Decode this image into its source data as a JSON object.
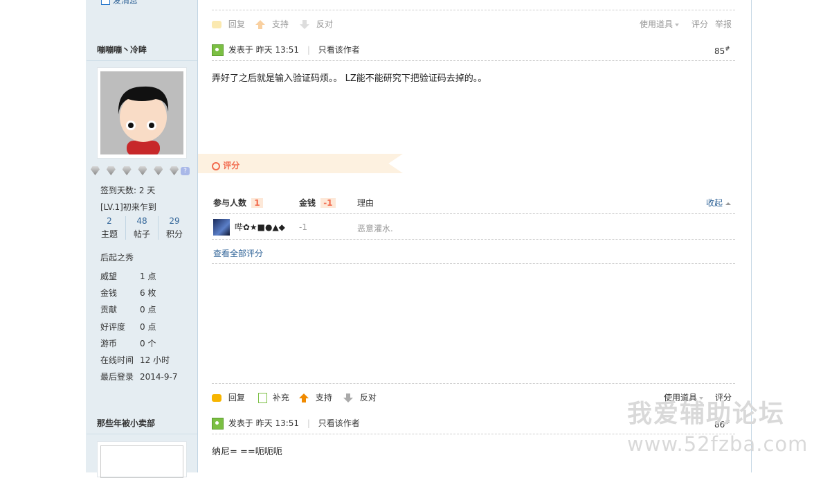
{
  "sidebar": {
    "top_link": "发消息",
    "user1": {
      "name": "嘣嘣嘣丶冷眸",
      "stats": [
        {
          "value": "2",
          "label": "主题"
        },
        {
          "value": "48",
          "label": "帖子"
        },
        {
          "value": "29",
          "label": "积分"
        }
      ],
      "sign_days": "签到天数: 2 天",
      "level": "[LV.1]初来乍到",
      "title": "后起之秀",
      "details": [
        {
          "key": "威望",
          "value": "1 点"
        },
        {
          "key": "金钱",
          "value": "6 枚"
        },
        {
          "key": "贡献",
          "value": "0 点"
        },
        {
          "key": "好评度",
          "value": "0 点"
        },
        {
          "key": "游币",
          "value": "0 个"
        },
        {
          "key": "在线时间",
          "value": "12 小时"
        },
        {
          "key": "最后登录",
          "value": "2014-9-7"
        }
      ]
    },
    "user2": {
      "name": "那些年被小卖部"
    }
  },
  "post85": {
    "top_actions": {
      "reply": "回复",
      "support": "支持",
      "oppose": "反对",
      "tools": "使用道具",
      "rate": "评分",
      "report": "举报"
    },
    "posted": "发表于 昨天 13:51",
    "only_author": "只看该作者",
    "floor": "85",
    "floor_mark": "#",
    "content": "弄好了之后就是输入验证码烦。。 LZ能不能研究下把验证码去掉的。。",
    "rating_title": "评分",
    "rating": {
      "participants_label": "参与人数",
      "participants": "1",
      "money_label": "金钱",
      "money": "-1",
      "reason_label": "理由",
      "collapse": "收起",
      "rows": [
        {
          "user": "哔✿★■●▲◆",
          "money": "-1",
          "reason": "恶意灌水."
        }
      ],
      "view_all": "查看全部评分"
    },
    "bottom_actions": {
      "reply": "回复",
      "supplement": "补充",
      "support": "支持",
      "oppose": "反对",
      "tools": "使用道具",
      "rate": "评分"
    }
  },
  "post86": {
    "posted": "发表于 昨天 13:51",
    "only_author": "只看该作者",
    "floor": "86",
    "floor_mark": "#",
    "content": "纳尼= ==呃呃呃"
  },
  "watermark": {
    "line1": "我爱辅助论坛",
    "line2": "www.52fzba.com"
  },
  "colors": {
    "sidebar_bg": "#e5edf2",
    "border": "#c2d5e3",
    "link": "#336699",
    "rating_accent": "#f26c4f",
    "rating_bg": "#fdf1e0"
  }
}
